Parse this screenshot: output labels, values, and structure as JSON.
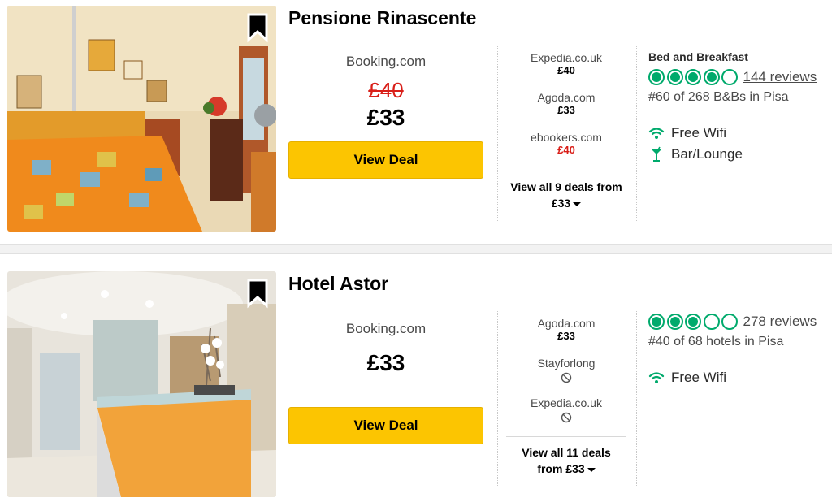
{
  "listings": [
    {
      "name": "Pensione Rinascente",
      "main_provider": "Booking.com",
      "old_price": "£40",
      "price": "£33",
      "view_deal": "View Deal",
      "deals": [
        {
          "provider": "Expedia.co.uk",
          "price": "£40"
        },
        {
          "provider": "Agoda.com",
          "price": "£33"
        },
        {
          "provider": "ebookers.com",
          "price": "£40",
          "price_color": "#d91e18"
        }
      ],
      "view_all_line1": "View all 9 deals from",
      "view_all_line2": "£33",
      "property_type": "Bed and Breakfast",
      "rating_bubbles": 4,
      "reviews": "144 reviews",
      "rank": "#60 of 268 B&Bs in Pisa",
      "amenities": [
        {
          "icon": "wifi-icon",
          "label": "Free Wifi"
        },
        {
          "icon": "cocktail-icon",
          "label": "Bar/Lounge"
        }
      ]
    },
    {
      "name": "Hotel Astor",
      "main_provider": "Booking.com",
      "price": "£33",
      "view_deal": "View Deal",
      "deals": [
        {
          "provider": "Agoda.com",
          "price": "£33"
        },
        {
          "provider": "Stayforlong",
          "unavailable_icon": "unavailable-icon"
        },
        {
          "provider": "Expedia.co.uk",
          "unavailable_icon": "unavailable-icon"
        }
      ],
      "view_all_line1": "View all 11 deals",
      "view_all_line2": "from £33",
      "rating_bubbles": 3,
      "reviews": "278 reviews",
      "rank": "#40 of 68 hotels in Pisa",
      "amenities": [
        {
          "icon": "wifi-icon",
          "label": "Free Wifi"
        }
      ]
    }
  ],
  "colors": {
    "accent_button": "#fcc501",
    "rating_green": "#00aa6c",
    "strike_red": "#d91e18"
  }
}
